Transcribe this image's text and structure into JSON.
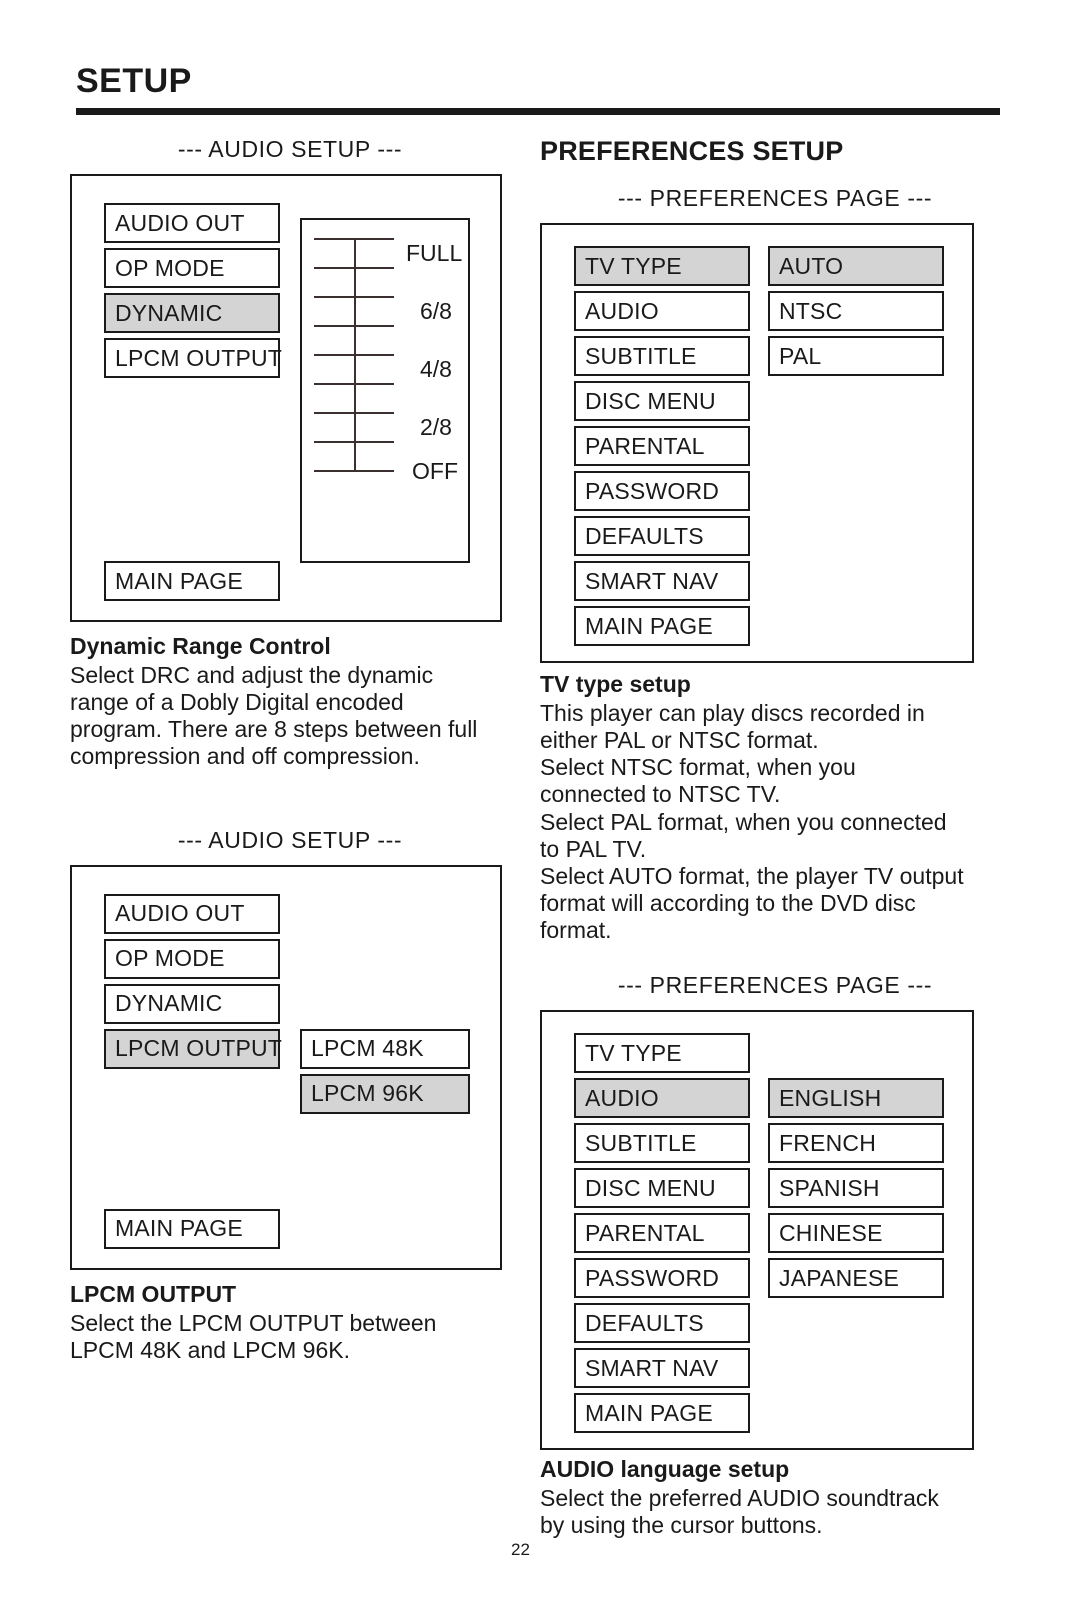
{
  "header": {
    "title": "SETUP"
  },
  "left_column": {
    "audio_setup_caption_1": "--- AUDIO SETUP ---",
    "audio_menu_1": {
      "items": [
        {
          "label": "AUDIO OUT",
          "highlighted": false
        },
        {
          "label": "OP MODE",
          "highlighted": false
        },
        {
          "label": "DYNAMIC",
          "highlighted": true
        },
        {
          "label": "LPCM OUTPUT",
          "highlighted": false
        }
      ],
      "main_page": "MAIN PAGE",
      "drc_scale_labels": [
        "FULL",
        "6/8",
        "4/8",
        "2/8",
        "OFF"
      ],
      "drc_tick_count": 9
    },
    "drc_section": {
      "heading": "Dynamic Range Control",
      "lines": [
        "Select DRC and adjust the dynamic",
        "range of a Dobly Digital encoded",
        "program.  There are 8 steps between full",
        "compression and off compression."
      ]
    },
    "audio_setup_caption_2": "--- AUDIO SETUP ---",
    "audio_menu_2": {
      "items": [
        {
          "label": "AUDIO OUT",
          "highlighted": false
        },
        {
          "label": "OP MODE",
          "highlighted": false
        },
        {
          "label": "DYNAMIC",
          "highlighted": false
        },
        {
          "label": "LPCM OUTPUT",
          "highlighted": true
        }
      ],
      "options": [
        {
          "label": "LPCM 48K",
          "highlighted": false
        },
        {
          "label": "LPCM 96K",
          "highlighted": true
        }
      ],
      "main_page": "MAIN PAGE"
    },
    "lpcm_section": {
      "heading": "LPCM OUTPUT",
      "lines": [
        "Select the LPCM OUTPUT between",
        "LPCM 48K and LPCM 96K."
      ]
    }
  },
  "right_column": {
    "section_title": "PREFERENCES SETUP",
    "preferences_caption_1": "--- PREFERENCES PAGE ---",
    "preferences_menu_1": {
      "items": [
        {
          "label": "TV TYPE",
          "highlighted": true
        },
        {
          "label": "AUDIO",
          "highlighted": false
        },
        {
          "label": "SUBTITLE",
          "highlighted": false
        },
        {
          "label": "DISC MENU",
          "highlighted": false
        },
        {
          "label": "PARENTAL",
          "highlighted": false
        },
        {
          "label": "PASSWORD",
          "highlighted": false
        },
        {
          "label": "DEFAULTS",
          "highlighted": false
        },
        {
          "label": "SMART NAV",
          "highlighted": false
        },
        {
          "label": "MAIN PAGE",
          "highlighted": false
        }
      ],
      "options": [
        {
          "label": "AUTO",
          "highlighted": true
        },
        {
          "label": "NTSC",
          "highlighted": false
        },
        {
          "label": "PAL",
          "highlighted": false
        }
      ]
    },
    "tv_type_section": {
      "heading": "TV type setup",
      "lines": [
        "This player can play discs recorded in",
        "either PAL or NTSC format.",
        "Select NTSC format, when you",
        "connected to NTSC TV.",
        "Select PAL format, when you connected",
        "to PAL TV.",
        "Select AUTO format, the player TV output",
        "format will according to the DVD disc",
        "format."
      ]
    },
    "preferences_caption_2": "--- PREFERENCES PAGE ---",
    "preferences_menu_2": {
      "items": [
        {
          "label": "TV TYPE",
          "highlighted": false
        },
        {
          "label": "AUDIO",
          "highlighted": true
        },
        {
          "label": "SUBTITLE",
          "highlighted": false
        },
        {
          "label": "DISC MENU",
          "highlighted": false
        },
        {
          "label": "PARENTAL",
          "highlighted": false
        },
        {
          "label": "PASSWORD",
          "highlighted": false
        },
        {
          "label": "DEFAULTS",
          "highlighted": false
        },
        {
          "label": "SMART NAV",
          "highlighted": false
        },
        {
          "label": "MAIN PAGE",
          "highlighted": false
        }
      ],
      "options": [
        {
          "label": "ENGLISH",
          "highlighted": true
        },
        {
          "label": "FRENCH",
          "highlighted": false
        },
        {
          "label": "SPANISH",
          "highlighted": false
        },
        {
          "label": "CHINESE",
          "highlighted": false
        },
        {
          "label": "JAPANESE",
          "highlighted": false
        }
      ]
    },
    "audio_language_section": {
      "heading": "AUDIO language setup",
      "lines": [
        "Select the preferred AUDIO soundtrack",
        "by using the cursor buttons."
      ]
    }
  },
  "footer": {
    "page_number": "22"
  },
  "colors": {
    "ink": "#1a1a1a",
    "highlight": "#d4d4d4"
  }
}
